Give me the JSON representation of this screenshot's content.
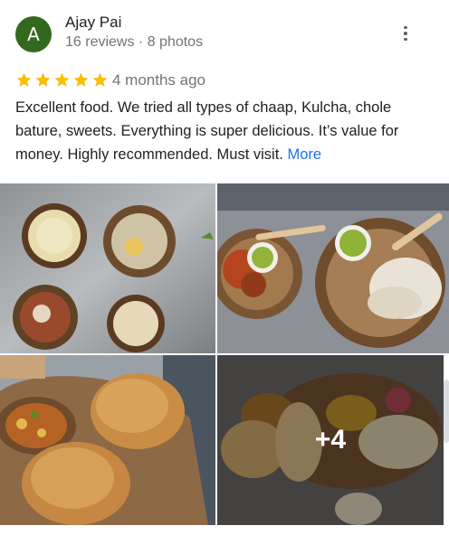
{
  "reviewer": {
    "initial": "A",
    "name": "Ajay Pai",
    "meta": "16 reviews · 8 photos",
    "avatar_color": "#33691e"
  },
  "rating": {
    "stars": 5,
    "max": 5,
    "star_color": "#fbbc04"
  },
  "time": "4 months ago",
  "review": {
    "text": "Excellent food. We tried all types of chaap, Kulcha, chole bature, sweets. Everything is super delicious. It’s value for money. Highly recommended. Must visit.",
    "more_label": "More",
    "more_color": "#1a73e8"
  },
  "photos": {
    "more_count_label": "+4"
  },
  "icons": {
    "menu": "more-vert-icon",
    "star": "star-icon"
  }
}
